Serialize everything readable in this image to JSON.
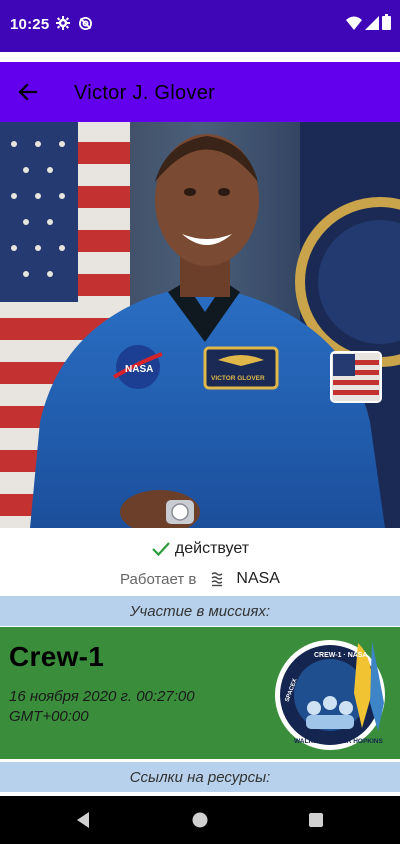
{
  "status_bar": {
    "time": "10:25",
    "icons": [
      "gear-icon",
      "sync-off-icon",
      "wifi-icon",
      "cell-signal-icon",
      "battery-icon"
    ]
  },
  "app_bar": {
    "title": "Victor J. Glover",
    "back_icon": "arrow-left-icon",
    "color": "#6200ee"
  },
  "portrait": {
    "badge_text": "VICTOR GLOVER"
  },
  "profile": {
    "status_label": "действует",
    "status_icon": "check-icon",
    "works_label": "Работает в",
    "agency_name": "NASA"
  },
  "missions_section": {
    "title": "Участие в миссиях:"
  },
  "mission": {
    "name": "Crew-1",
    "date": "16 ноября 2020 г. 00:27:00",
    "timezone": "GMT+00:00",
    "card_color": "#3a8e3b",
    "patch": {
      "top_text": "CREW-1 · NASA",
      "left_text": "SPACEX",
      "bottom_text": "WALKER GLOVER HOPKINS"
    }
  },
  "links_section": {
    "title": "Ссылки на ресурсы:"
  },
  "nav_bar": {
    "icons": [
      "nav-back-icon",
      "nav-home-icon",
      "nav-recents-icon"
    ]
  }
}
